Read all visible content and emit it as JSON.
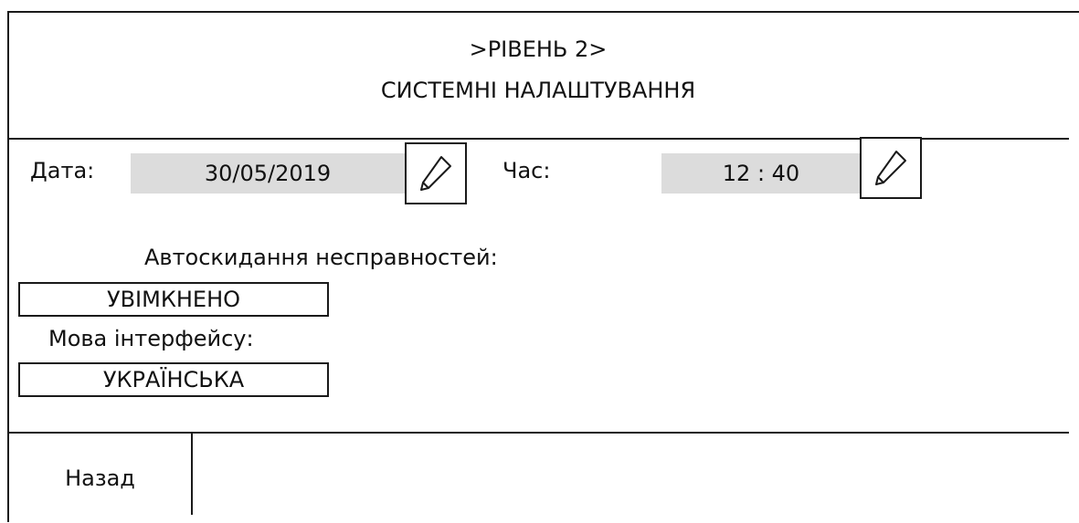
{
  "header": {
    "level": ">РІВЕНЬ 2>",
    "title": "СИСТЕМНІ НАЛАШТУВАННЯ"
  },
  "date": {
    "label": "Дата:",
    "value": "30/05/2019",
    "edit_icon": "pencil-icon"
  },
  "time": {
    "label": "Час:",
    "value": "12 : 40",
    "edit_icon": "pencil-icon"
  },
  "auto_reset": {
    "label": "Автоскидання несправностей:",
    "value": "УВІМКНЕНО"
  },
  "language": {
    "label": "Мова інтерфейсу:",
    "value": "УКРАЇНСЬКА"
  },
  "footer": {
    "back_label": "Назад"
  },
  "colors": {
    "value_background": "#dcdcdc",
    "border": "#1a1a1a"
  }
}
